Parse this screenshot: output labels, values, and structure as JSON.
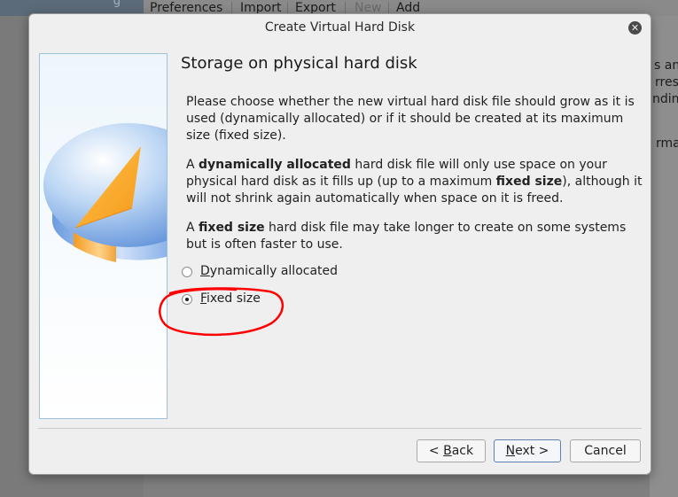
{
  "background_app": {
    "left_fragment": "g",
    "menu": [
      {
        "label": "Preferences",
        "disabled": false
      },
      {
        "label": "Import",
        "disabled": false
      },
      {
        "label": "Export",
        "disabled": false
      },
      {
        "label": "New",
        "disabled": true
      },
      {
        "label": "Add",
        "disabled": false
      }
    ],
    "right_fragments": [
      "s and",
      "rresp",
      "nding",
      "rmat"
    ]
  },
  "dialog": {
    "title": "Create Virtual Hard Disk",
    "close_icon": "close-icon",
    "heading": "Storage on physical hard disk",
    "para1": "Please choose whether the new virtual hard disk file should grow as it is used (dynamically allocated) or if it should be created at its maximum size (fixed size).",
    "para2": {
      "t1": "A ",
      "b1": "dynamically allocated",
      "t2": " hard disk file will only use space on your physical hard disk as it fills up (up to a maximum ",
      "b2": "fixed size",
      "t3": "), although it will not shrink again automatically when space on it is freed."
    },
    "para3": {
      "t1": "A ",
      "b1": "fixed size",
      "t2": " hard disk file may take longer to create on some systems but is often faster to use."
    },
    "options": [
      {
        "mnemonic": "D",
        "rest": "ynamically allocated",
        "checked": false
      },
      {
        "mnemonic": "F",
        "rest": "ixed size",
        "checked": true
      }
    ],
    "buttons": {
      "back": {
        "prefix": "< ",
        "mnemonic": "B",
        "rest": "ack"
      },
      "next": {
        "mnemonic": "N",
        "rest": "ext >"
      },
      "cancel": "Cancel"
    }
  },
  "colors": {
    "annotation": "#ff0000",
    "accent": "#5e81b5"
  }
}
